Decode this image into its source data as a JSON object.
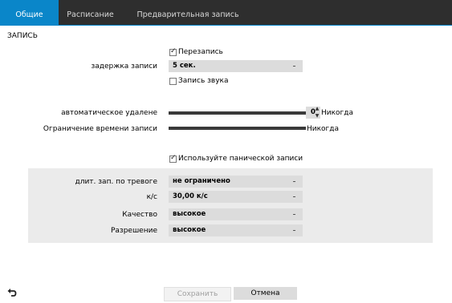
{
  "tabs": [
    {
      "label": "Общие",
      "active": true
    },
    {
      "label": "Расписание",
      "active": false
    },
    {
      "label": "Предварительная запись",
      "active": false
    }
  ],
  "section_title": "ЗАПИСЬ",
  "overwrite": {
    "label": "Перезапись",
    "checked": true
  },
  "record_delay": {
    "label": "задержка записи",
    "value": "5 сек."
  },
  "audio_record": {
    "label": "Запись звука",
    "checked": false
  },
  "auto_delete": {
    "label": "автоматическое удалене",
    "value": "0",
    "text": "Никогда",
    "level": 1.0
  },
  "record_time_limit": {
    "label": "Ограничение времени записи",
    "text": "Никогда",
    "level": 1.0
  },
  "panic_record": {
    "label": "Используйте панической записи",
    "checked": true
  },
  "alarm_panel": {
    "alarm_duration": {
      "label": "длит. зап. по тревоге",
      "value": "не ограничено"
    },
    "fps": {
      "label": "к/с",
      "value": "30,00 к/с"
    },
    "quality": {
      "label": "Качество",
      "value": "высокое"
    },
    "resolution": {
      "label": "Разрешение",
      "value": "высокое"
    }
  },
  "buttons": {
    "save": "Сохранить",
    "cancel": "Отмена"
  },
  "icons": {
    "back": "back-arrow-icon",
    "dropdown": "chevron-down-icon"
  },
  "colors": {
    "accent": "#0a86c9",
    "tabbar": "#2e2e2e",
    "panel": "#ebebeb",
    "field": "#dcdcdc"
  }
}
